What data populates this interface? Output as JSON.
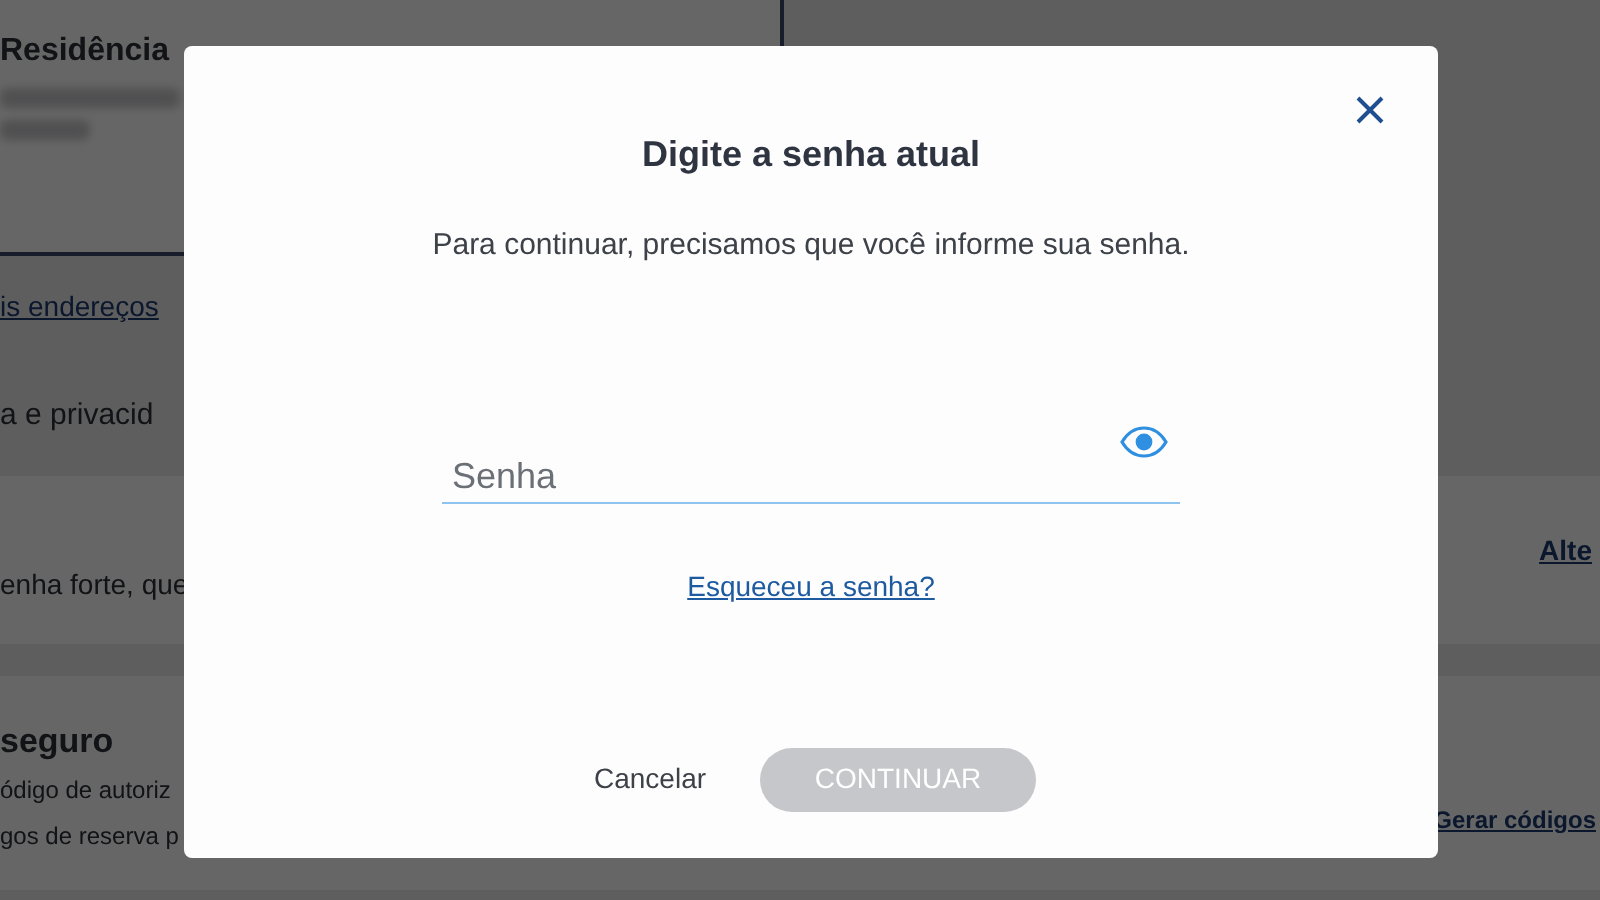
{
  "background": {
    "address_title": "Residência",
    "addresses_link": "is endereços",
    "section_heading": "a e privacid",
    "password_card": {
      "text": "enha forte, que",
      "link": "Alte"
    },
    "security_card": {
      "title": "seguro",
      "lines": [
        "ódigo de autoriz",
        "gos de reserva p"
      ],
      "link": "Gerar códigos"
    }
  },
  "dialog": {
    "title": "Digite a senha atual",
    "message": "Para continuar, precisamos que você informe sua senha.",
    "password_field": {
      "placeholder": "Senha"
    },
    "forgot_link": "Esqueceu a senha?",
    "cancel_button": "Cancelar",
    "continue_button": {
      "label": "CONTINUAR",
      "disabled": true
    }
  }
}
